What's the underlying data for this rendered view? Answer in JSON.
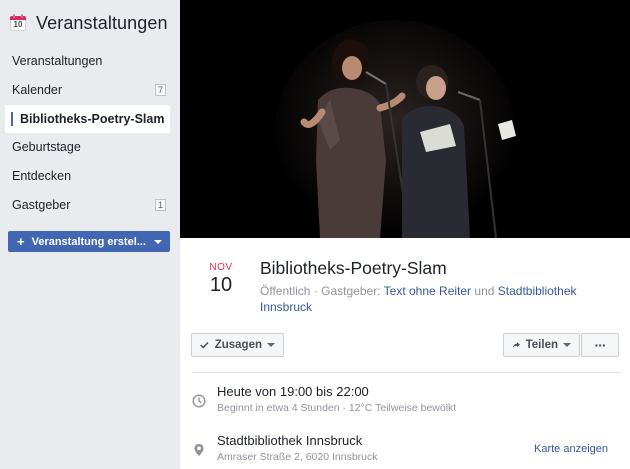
{
  "sidebar": {
    "title": "Veranstaltungen",
    "calendar_icon_day": "10",
    "items": [
      {
        "label": "Veranstaltungen",
        "badge": ""
      },
      {
        "label": "Kalender",
        "badge": "7"
      },
      {
        "label": "Bibliotheks-Poetry-Slam",
        "badge": ""
      },
      {
        "label": "Geburtstage",
        "badge": ""
      },
      {
        "label": "Entdecken",
        "badge": ""
      },
      {
        "label": "Gastgeber",
        "badge": "1"
      }
    ],
    "create_button": "Veranstaltung erstel..."
  },
  "event": {
    "month": "NOV",
    "day": "10",
    "title": "Bibliotheks-Poetry-Slam",
    "privacy": "Öffentlich",
    "host_prefix": "Gastgeber:",
    "host1": "Text ohne Reiter",
    "host_joiner": "und",
    "host2": "Stadtbibliothek Innsbruck"
  },
  "actions": {
    "going": "Zusagen",
    "share": "Teilen",
    "more": "···"
  },
  "details": {
    "time_main": "Heute von 19:00 bis 22:00",
    "time_sub": "Beginnt in etwa 4 Stunden · 12°C Teilweise bewölkt",
    "place_main": "Stadtbibliothek Innsbruck",
    "place_sub": "Amraser Straße 2, 6020 Innsbruck",
    "map_link": "Karte anzeigen"
  },
  "colors": {
    "accent": "#4267b2",
    "month": "#f02849",
    "link": "#365899"
  }
}
